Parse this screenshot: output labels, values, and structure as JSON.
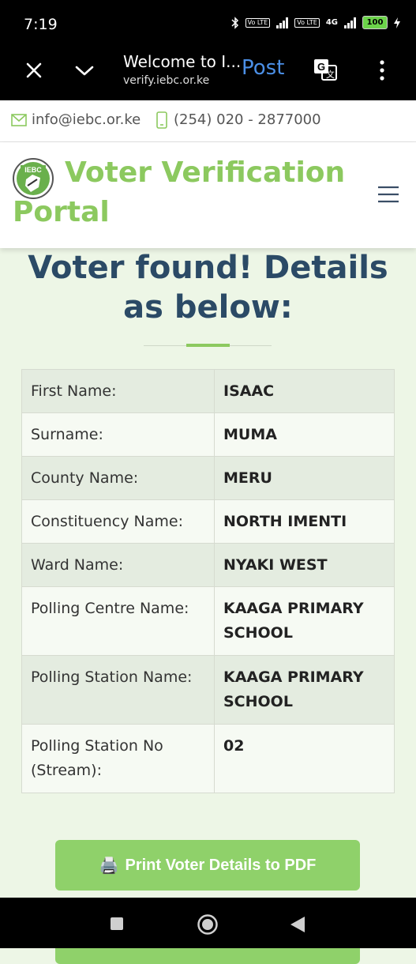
{
  "status_bar": {
    "time": "7:19",
    "volte1": "Vo LTE",
    "volte2": "Vo LTE",
    "network": "4G",
    "battery": "100"
  },
  "browser_bar": {
    "title": "Welcome to I...",
    "url": "verify.iebc.or.ke",
    "post_label": "Post"
  },
  "contact": {
    "email": "info@iebc.or.ke",
    "phone": "(254) 020 - 2877000"
  },
  "header": {
    "brand_line1": "Voter Verification",
    "brand_line2": "Portal",
    "logo_text": "IEBC"
  },
  "main": {
    "heading": "Voter found! Details as below:",
    "details": [
      {
        "label": "First Name:",
        "value": "ISAAC"
      },
      {
        "label": "Surname:",
        "value": "MUMA"
      },
      {
        "label": "County Name:",
        "value": "MERU"
      },
      {
        "label": "Constituency Name:",
        "value": "NORTH IMENTI"
      },
      {
        "label": "Ward Name:",
        "value": "NYAKI WEST"
      },
      {
        "label": "Polling Centre Name:",
        "value": "KAAGA PRIMARY SCHOOL"
      },
      {
        "label": "Polling Station Name:",
        "value": "KAAGA PRIMARY SCHOOL"
      },
      {
        "label": "Polling Station No (Stream):",
        "value": "02"
      }
    ],
    "print_icon": "🖨️",
    "print_label": "Print Voter Details to PDF"
  },
  "colors": {
    "accent_green": "#8cc95f",
    "heading_blue": "#2b4a66",
    "button_green": "#8fd16a"
  }
}
